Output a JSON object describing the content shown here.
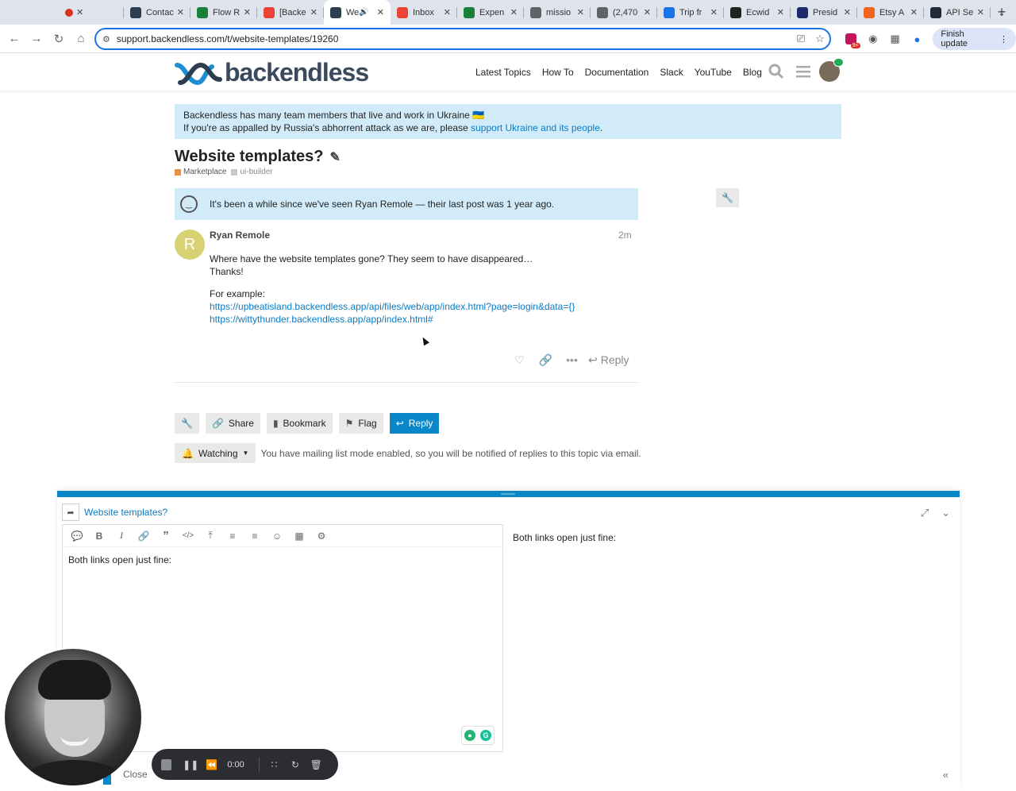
{
  "browser": {
    "tabs": [
      {
        "title": "",
        "icon": "record-dot-icon",
        "color": "#d93025",
        "active": false
      },
      {
        "title": "Contac",
        "icon": "backendless-icon",
        "color": "#2c3e50",
        "active": false
      },
      {
        "title": "Flow R",
        "icon": "sheets-icon",
        "color": "#188038",
        "active": false
      },
      {
        "title": "[Backe",
        "icon": "gmail-icon",
        "color": "#ea4335",
        "active": false
      },
      {
        "title": "We",
        "icon": "backendless-icon",
        "color": "#2c3e50",
        "active": true
      },
      {
        "title": "Inbox",
        "icon": "gmail-icon",
        "color": "#ea4335",
        "active": false
      },
      {
        "title": "Expen",
        "icon": "sheets-icon",
        "color": "#188038",
        "active": false
      },
      {
        "title": "missio",
        "icon": "globe-icon",
        "color": "#5f6368",
        "active": false
      },
      {
        "title": "(2,470",
        "icon": "mail-icon",
        "color": "#5f6368",
        "active": false
      },
      {
        "title": "Trip fr",
        "icon": "trip-icon",
        "color": "#1a73e8",
        "active": false
      },
      {
        "title": "Ecwid",
        "icon": "ecwid-icon",
        "color": "#222222",
        "active": false
      },
      {
        "title": "Presid",
        "icon": "flag-icon",
        "color": "#1d2b6b",
        "active": false
      },
      {
        "title": "Etsy A",
        "icon": "etsy-icon",
        "color": "#f1641e",
        "active": false
      },
      {
        "title": "API Se",
        "icon": "api-icon",
        "color": "#1f2a36",
        "active": false
      }
    ],
    "url": "support.backendless.com/t/website-templates/19260",
    "finish_update": "Finish update",
    "extension_badge": "9+"
  },
  "site": {
    "logo_text": "backendless",
    "nav": [
      "Latest Topics",
      "How To",
      "Documentation",
      "Slack",
      "YouTube",
      "Blog"
    ]
  },
  "banner": {
    "line1": "Backendless has many team members that live and work in Ukraine 🇺🇦",
    "line2_prefix": "If you're as appalled by Russia's abhorrent attack as we are, please ",
    "line2_link": "support Ukraine and its people",
    "line2_suffix": "."
  },
  "topic": {
    "title": "Website templates?",
    "category": "Marketplace",
    "category_color": "#e6923a",
    "tag": "ui-builder",
    "tag_color": "#c9c9c9"
  },
  "notice": "It's been a while since we've seen Ryan Remole — their last post was 1 year ago.",
  "post": {
    "avatar_letter": "R",
    "author": "Ryan Remole",
    "time": "2m",
    "line1": "Where have the website templates gone? They seem to have disappeared…",
    "line2": "Thanks!",
    "example_label": "For example:",
    "link1": "https://upbeatisland.backendless.app/api/files/web/app/index.html?page=login&data={}",
    "link2": "https://wittythunder.backendless.app/app/index.html#",
    "reply_label": "Reply"
  },
  "footer": {
    "share": "Share",
    "bookmark": "Bookmark",
    "flag": "Flag",
    "reply": "Reply",
    "watching": "Watching",
    "watching_text": "You have mailing list mode enabled, so you will be notified of replies to this topic via email."
  },
  "composer": {
    "topic_link": "Website templates?",
    "editor_text": "Both links open just fine:",
    "preview_text": "Both links open just fine:",
    "close_label": "Close"
  },
  "recorder": {
    "time": "0:00"
  }
}
